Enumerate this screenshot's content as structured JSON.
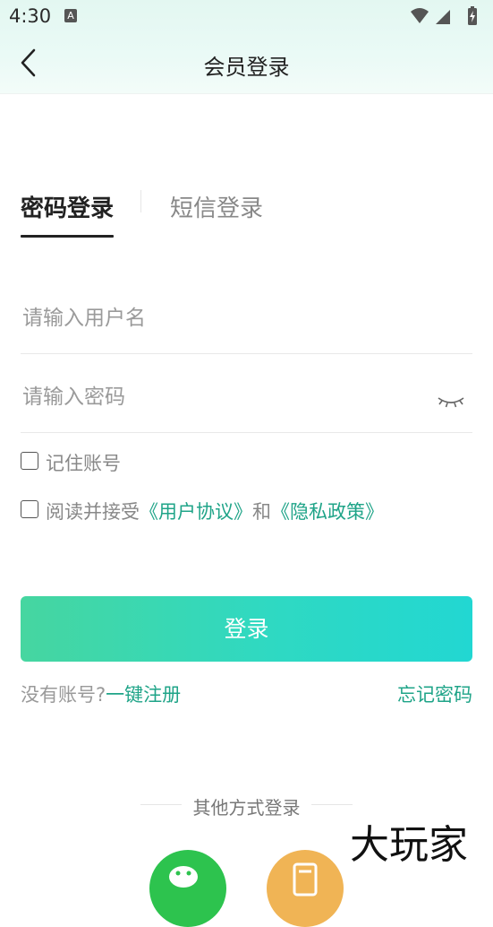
{
  "status": {
    "time": "4:30",
    "notification": "A"
  },
  "header": {
    "title": "会员登录"
  },
  "tabs": [
    {
      "label": "密码登录",
      "active": true
    },
    {
      "label": "短信登录",
      "active": false
    }
  ],
  "form": {
    "username_placeholder": "请输入用户名",
    "password_placeholder": "请输入密码",
    "remember_label": "记住账号",
    "agree_prefix": "阅读并接受",
    "user_agreement": "《用户协议》",
    "and": "和",
    "privacy_policy": "《隐私政策》"
  },
  "login_button": "登录",
  "links": {
    "no_account": "没有账号?",
    "register": "一键注册",
    "forgot": "忘记密码"
  },
  "other_login": {
    "title": "其他方式登录"
  },
  "colors": {
    "accent": "#1fa488",
    "gradient_start": "#46d6a0",
    "gradient_end": "#22d7d2",
    "wechat": "#2dc34e",
    "alt": "#f0b455"
  },
  "watermark": "大玩家"
}
